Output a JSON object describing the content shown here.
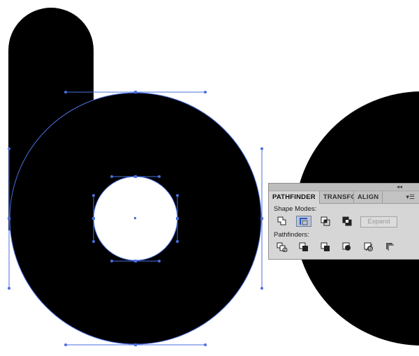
{
  "panel": {
    "tabs": [
      "PATHFINDER",
      "TRANSFO",
      "ALIGN"
    ],
    "shape_modes_label": "Shape Modes:",
    "pathfinders_label": "Pathfinders:",
    "expand_label": "Expand",
    "shape_mode_icons": [
      "unite-icon",
      "minus-front-icon",
      "intersect-icon",
      "exclude-icon"
    ],
    "pathfinder_icons": [
      "divide-icon",
      "trim-icon",
      "merge-icon",
      "crop-icon",
      "outline-icon",
      "minus-back-icon"
    ],
    "active_tab": "PATHFINDER",
    "pressed_shape_mode": "minus-front-icon"
  },
  "colors": {
    "shape_fill": "#000000",
    "selection": "#4a6fe0",
    "panel_bg": "#d6d6d6"
  }
}
